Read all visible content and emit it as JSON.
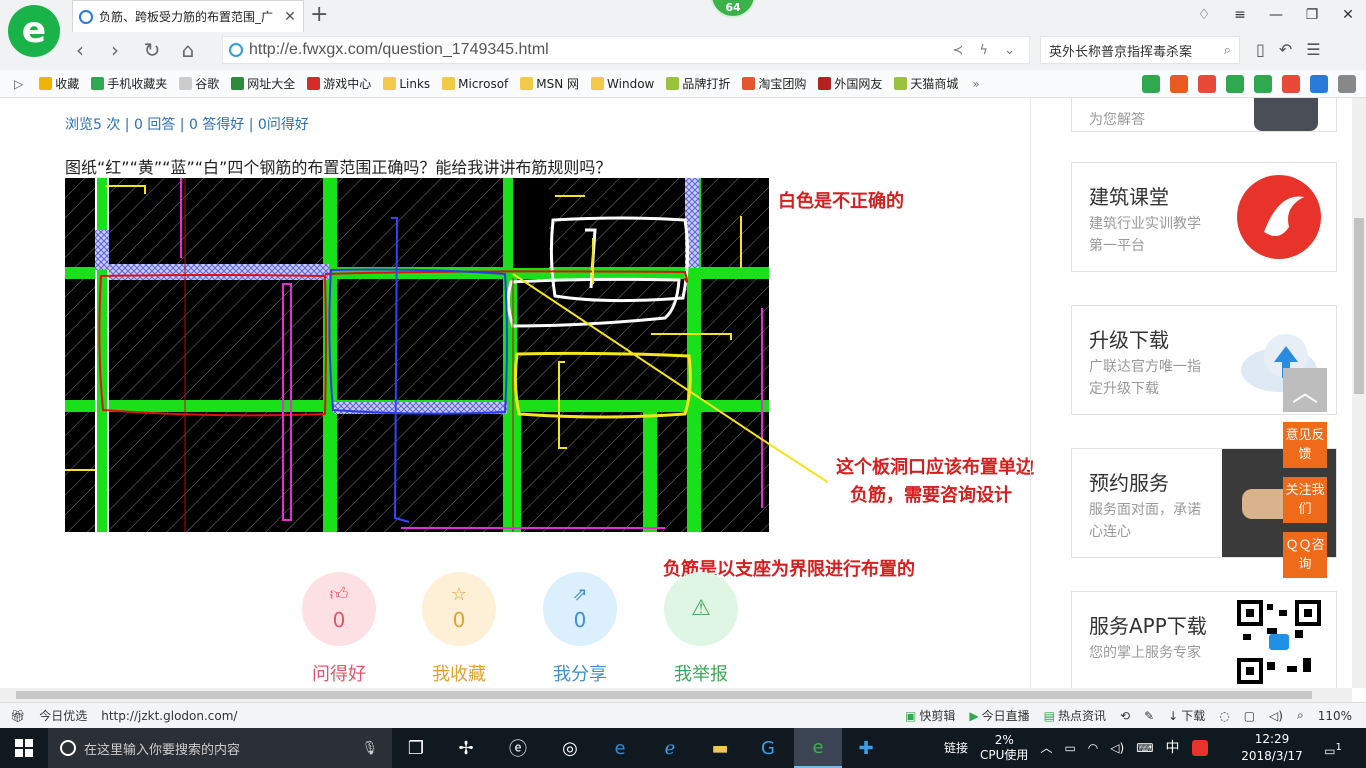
{
  "browser": {
    "tab_title": "负筋、跨板受力筋的布置范围_广",
    "update_badge": "64",
    "url": "http://e.fwxgx.com/question_1749345.html",
    "search_text": "英外长称普京指挥毒杀案"
  },
  "bookmarks": [
    {
      "label": "收藏",
      "color": "#f0b400"
    },
    {
      "label": "手机收藏夹",
      "color": "#2fa84f"
    },
    {
      "label": "谷歌",
      "color": "#cccccc"
    },
    {
      "label": "网址大全",
      "color": "#2e8b3a"
    },
    {
      "label": "游戏中心",
      "color": "#d62a2a"
    },
    {
      "label": "Links",
      "color": "#f3c948"
    },
    {
      "label": "Microsof",
      "color": "#f3c948"
    },
    {
      "label": "MSN 网",
      "color": "#f3c948"
    },
    {
      "label": "Window",
      "color": "#f3c948"
    },
    {
      "label": "品牌打折",
      "color": "#9ac23c"
    },
    {
      "label": "淘宝团购",
      "color": "#e4572e"
    },
    {
      "label": "外国网友",
      "color": "#b22222"
    },
    {
      "label": "天猫商城",
      "color": "#9ac23c"
    }
  ],
  "question": {
    "stats": "浏览5 次 | 0 回答 | 0 答得好 | 0问得好",
    "text": "图纸“红”“黄”“蓝”“白”四个钢筋的布置范围正确吗？能给我讲讲布筋规则吗？"
  },
  "annotations": {
    "white_note": "白色是不正确的",
    "hole_note_line1": "这个板洞口应该布置单边",
    "hole_note_line2": "负筋，需要咨询设计",
    "rule_note": "负筋是以支座为界限进行布置的"
  },
  "actions": [
    {
      "label": "问得好",
      "count": "0",
      "icon": "thumbs-up-icon",
      "bg": "#fde0e3",
      "color": "#e2566a"
    },
    {
      "label": "我收藏",
      "count": "0",
      "icon": "star-icon",
      "bg": "#fdf0d6",
      "color": "#e0a12e"
    },
    {
      "label": "我分享",
      "count": "0",
      "icon": "share-icon",
      "bg": "#dbeffc",
      "color": "#3f8fd2"
    },
    {
      "label": "我举报",
      "count": "",
      "icon": "warning-icon",
      "bg": "#e0f6e4",
      "color": "#3aa858"
    }
  ],
  "sidebar": {
    "card0_desc": "为您解答",
    "cards": [
      {
        "title": "建筑课堂",
        "desc": "建筑行业实训教学第一平台"
      },
      {
        "title": "升级下载",
        "desc": "广联达官方唯一指定升级下载"
      },
      {
        "title": "预约服务",
        "desc": "服务面对面，承诺心连心"
      },
      {
        "title": "服务APP下载",
        "desc": "您的掌上服务专家"
      }
    ],
    "feedback": [
      {
        "label": "意见反馈"
      },
      {
        "label": "关注我们"
      },
      {
        "label": "ＱＱ咨询"
      }
    ]
  },
  "status_bar": {
    "today": "今日优选",
    "link_url": "http://jzkt.glodon.com/",
    "kuaijianji": "快剪辑",
    "live": "今日直播",
    "news": "热点资讯",
    "download": "下载",
    "zoom": "110%"
  },
  "taskbar": {
    "search_placeholder": "在这里输入你要搜索的内容",
    "tray_link": "链接",
    "cpu_value": "2%",
    "cpu_label": "CPU使用",
    "ime": "中",
    "time": "12:29",
    "date": "2018/3/17",
    "notifications": "1"
  }
}
